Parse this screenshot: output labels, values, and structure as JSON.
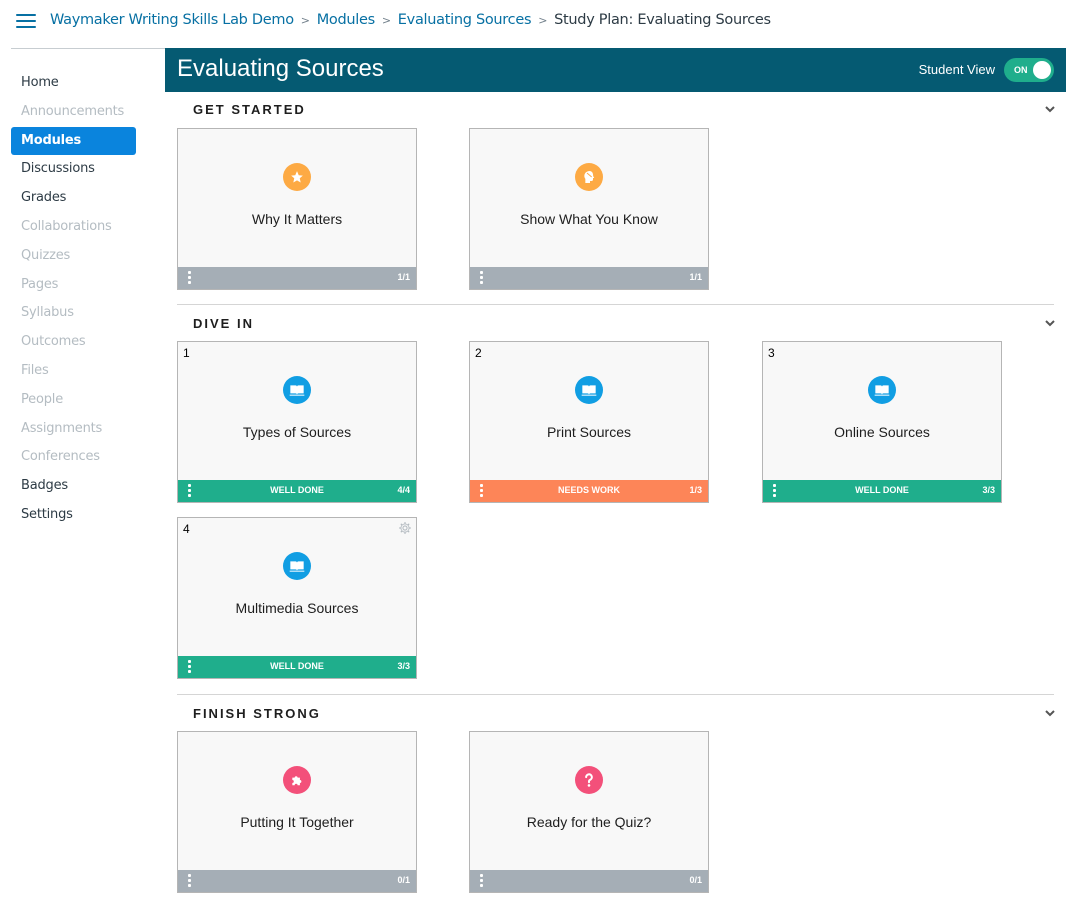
{
  "breadcrumb": {
    "items": [
      "Waymaker Writing Skills Lab Demo",
      "Modules",
      "Evaluating Sources"
    ],
    "current": "Study Plan: Evaluating Sources",
    "separator": ">"
  },
  "sidebar": {
    "items": [
      {
        "label": "Home",
        "state": "enabled"
      },
      {
        "label": "Announcements",
        "state": "disabled"
      },
      {
        "label": "Modules",
        "state": "active"
      },
      {
        "label": "Discussions",
        "state": "enabled"
      },
      {
        "label": "Grades",
        "state": "enabled"
      },
      {
        "label": "Collaborations",
        "state": "disabled"
      },
      {
        "label": "Quizzes",
        "state": "disabled"
      },
      {
        "label": "Pages",
        "state": "disabled"
      },
      {
        "label": "Syllabus",
        "state": "disabled"
      },
      {
        "label": "Outcomes",
        "state": "disabled"
      },
      {
        "label": "Files",
        "state": "disabled"
      },
      {
        "label": "People",
        "state": "disabled"
      },
      {
        "label": "Assignments",
        "state": "disabled"
      },
      {
        "label": "Conferences",
        "state": "disabled"
      },
      {
        "label": "Badges",
        "state": "enabled"
      },
      {
        "label": "Settings",
        "state": "enabled"
      }
    ]
  },
  "header": {
    "title": "Evaluating Sources",
    "student_view_label": "Student View",
    "toggle_state": "ON"
  },
  "colors": {
    "banner": "#055a72",
    "toggle": "#1fae8c",
    "well_done": "#1fae8c",
    "needs_work": "#fd8558",
    "neutral_footer": "#a5aeb6",
    "orange_icon": "#fdaa44",
    "blue_icon": "#119ee3",
    "pink_icon": "#f3507a",
    "link": "#0770a3",
    "active_nav": "#0a84dd"
  },
  "sections": [
    {
      "title": "GET STARTED",
      "cards": [
        {
          "number": "",
          "title": "Why It Matters",
          "icon": "star-icon",
          "status": "",
          "score": "1/1"
        },
        {
          "number": "",
          "title": "Show What You Know",
          "icon": "head-icon",
          "status": "",
          "score": "1/1"
        }
      ]
    },
    {
      "title": "DIVE IN",
      "cards": [
        {
          "number": "1",
          "title": "Types of Sources",
          "icon": "book-icon",
          "status": "WELL DONE",
          "score": "4/4"
        },
        {
          "number": "2",
          "title": "Print Sources",
          "icon": "book-icon",
          "status": "NEEDS WORK",
          "score": "1/3"
        },
        {
          "number": "3",
          "title": "Online Sources",
          "icon": "book-icon",
          "status": "WELL DONE",
          "score": "3/3"
        },
        {
          "number": "4",
          "title": "Multimedia Sources",
          "icon": "book-icon",
          "status": "WELL DONE",
          "score": "3/3"
        }
      ]
    },
    {
      "title": "FINISH STRONG",
      "cards": [
        {
          "number": "",
          "title": "Putting It Together",
          "icon": "puzzle-icon",
          "status": "",
          "score": "0/1"
        },
        {
          "number": "",
          "title": "Ready for the Quiz?",
          "icon": "question-icon",
          "status": "",
          "score": "0/1"
        }
      ]
    }
  ]
}
